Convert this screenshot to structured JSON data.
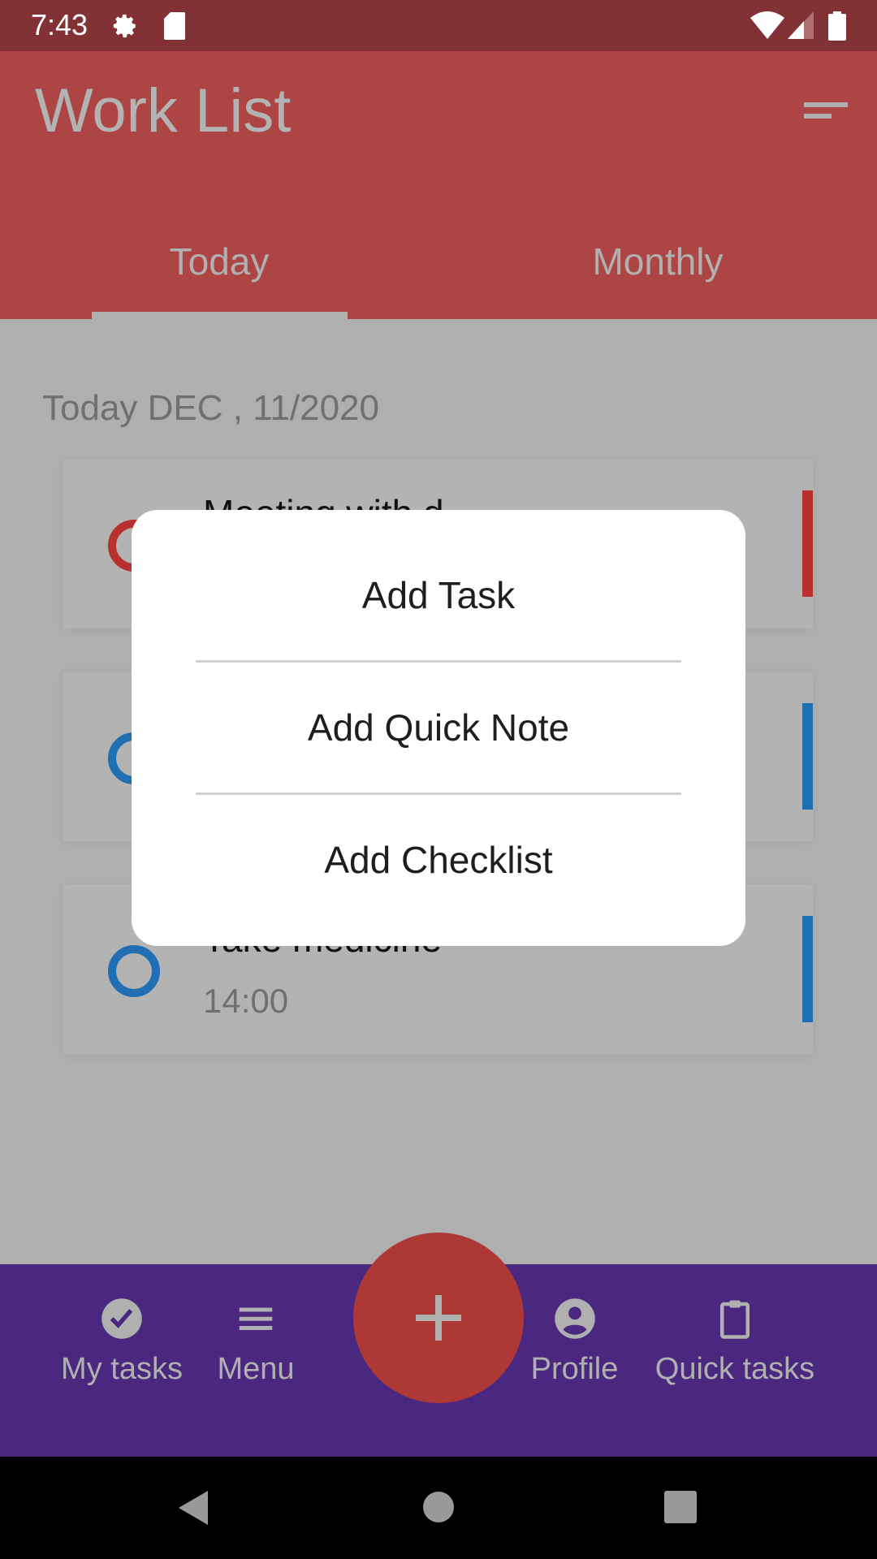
{
  "status_bar": {
    "time": "7:43"
  },
  "app_bar": {
    "title": "Work List"
  },
  "tabs": [
    {
      "label": "Today"
    },
    {
      "label": "Monthly"
    }
  ],
  "date_header": "Today DEC , 11/2020",
  "tasks": [
    {
      "title": "Meeting with d",
      "time": "",
      "color": "#b8312f"
    },
    {
      "title": "",
      "time": "",
      "color": "#1f6fb2"
    },
    {
      "title": "Take medicine",
      "time": "14:00",
      "color": "#1f6fb2"
    }
  ],
  "dialog": {
    "items": [
      {
        "label": "Add Task"
      },
      {
        "label": "Add Quick Note"
      },
      {
        "label": "Add Checklist"
      }
    ]
  },
  "bottom_nav": {
    "items": [
      {
        "label": "My tasks"
      },
      {
        "label": "Menu"
      },
      {
        "label": "Profile"
      },
      {
        "label": "Quick tasks"
      }
    ]
  }
}
